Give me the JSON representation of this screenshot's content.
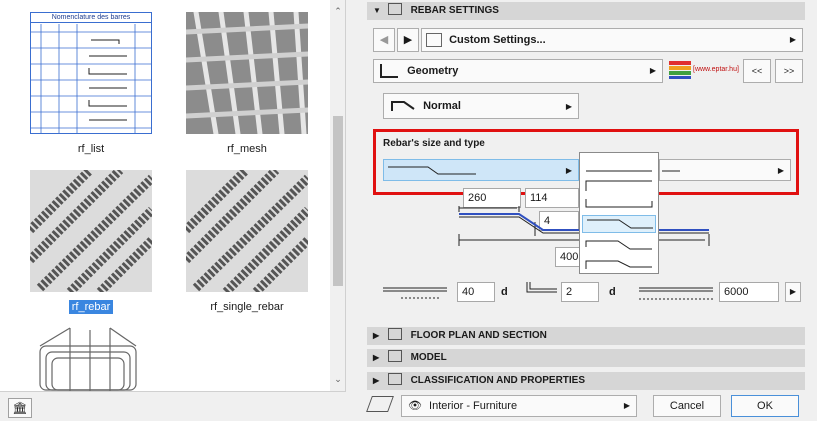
{
  "library": {
    "items": [
      {
        "label": "rf_list",
        "thumb_title": "Nomenclature des barres"
      },
      {
        "label": "rf_mesh"
      },
      {
        "label": "rf_rebar",
        "selected": true
      },
      {
        "label": "rf_single_rebar"
      }
    ]
  },
  "panel": {
    "rebar_settings": "REBAR SETTINGS",
    "custom_settings": "Custom Settings...",
    "geometry": "Geometry",
    "brand": "[www.eptar.hu]",
    "nav_prev": "<<",
    "nav_next": ">>",
    "normal": "Normal",
    "size_type_label": "Rebar's size and type",
    "dims": {
      "a": "260",
      "b": "114",
      "c": "4",
      "total": "400"
    },
    "bend_value": "40",
    "bend_unit": "d",
    "hook_value": "2",
    "hook_unit": "d",
    "length_value": "6000",
    "sections": [
      "FLOOR PLAN AND SECTION",
      "MODEL",
      "CLASSIFICATION AND PROPERTIES"
    ],
    "layer": "Interior - Furniture",
    "cancel": "Cancel",
    "ok": "OK"
  }
}
